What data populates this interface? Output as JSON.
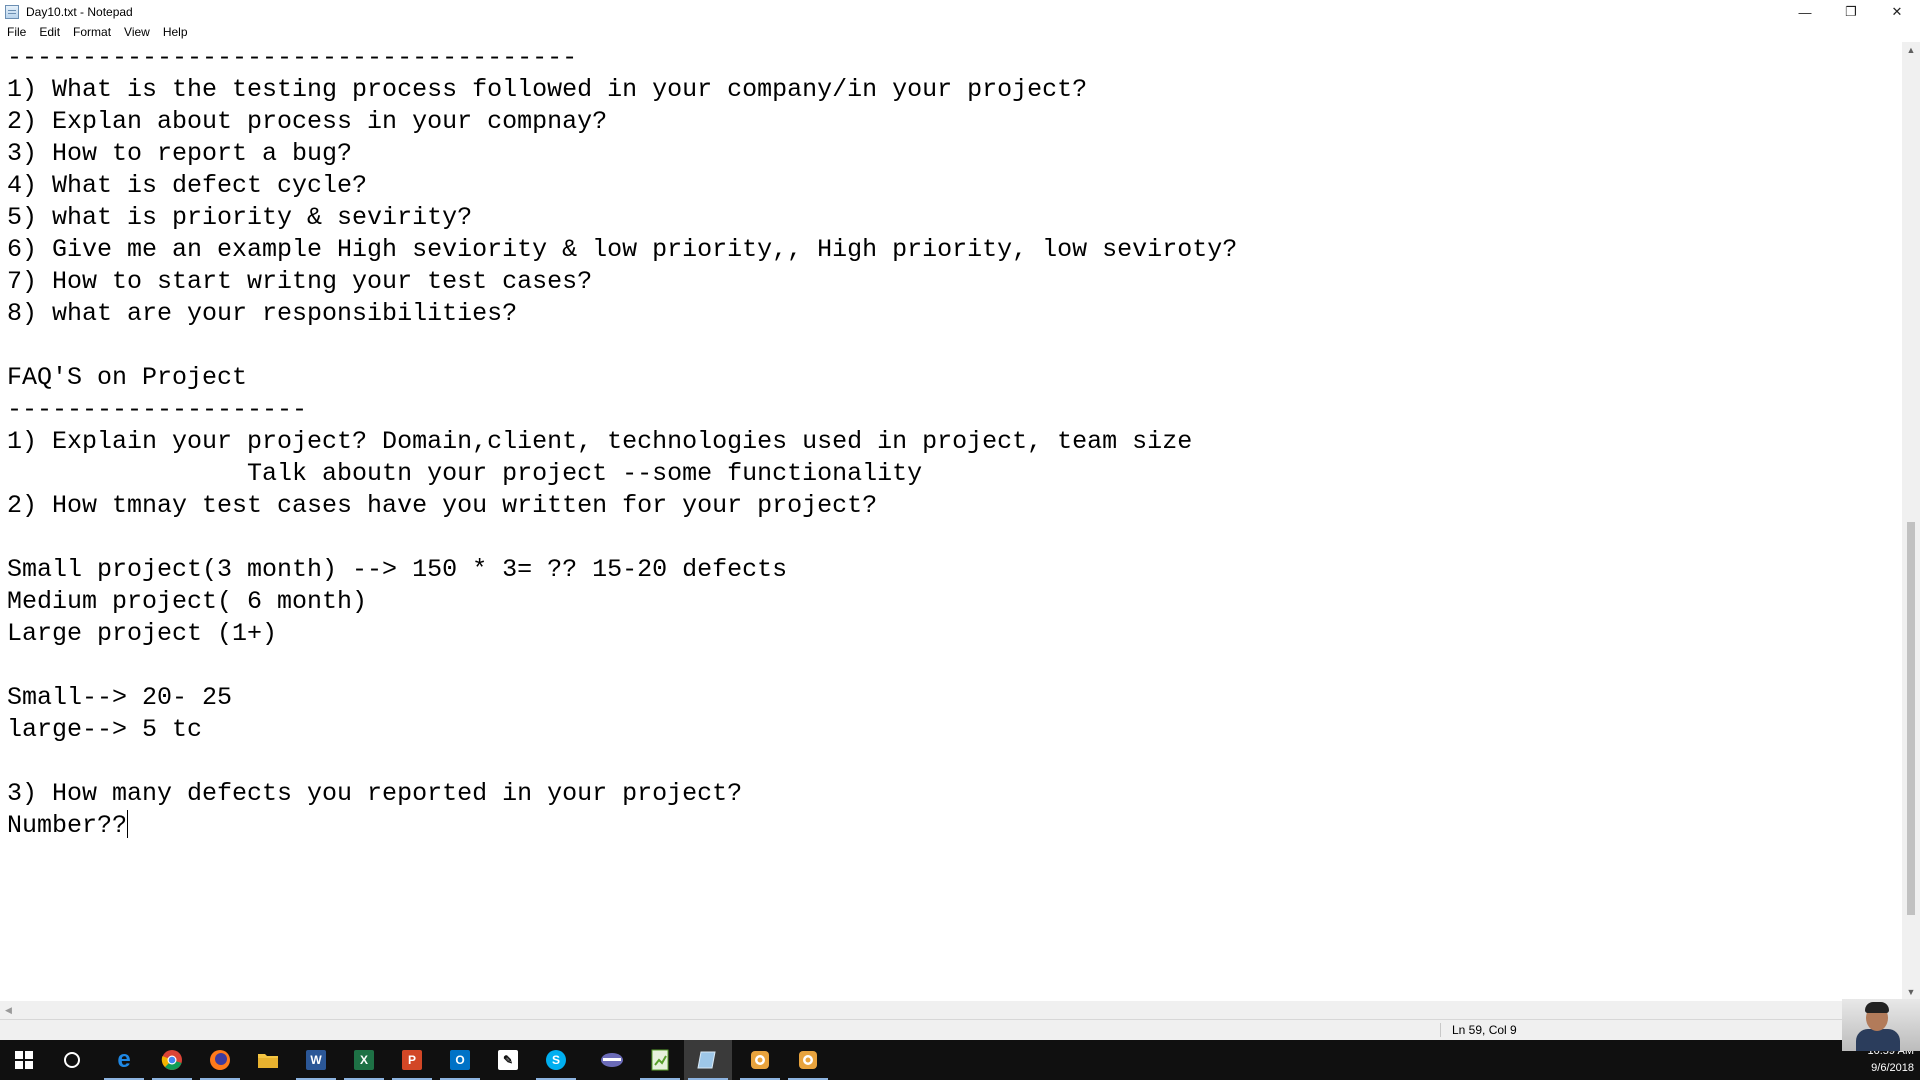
{
  "window": {
    "title": "Day10.txt - Notepad",
    "controls": {
      "minimize": "—",
      "restore": "❐",
      "close": "✕"
    }
  },
  "menu": [
    "File",
    "Edit",
    "Format",
    "View",
    "Help"
  ],
  "editor": {
    "lines": [
      "--------------------------------------",
      "1) What is the testing process followed in your company/in your project?",
      "2) Explan about process in your compnay?",
      "3) How to report a bug?",
      "4) What is defect cycle?",
      "5) what is priority & sevirity?",
      "6) Give me an example High seviority & low priority,, High priority, low seviroty?",
      "7) How to start writng your test cases?",
      "8) what are your responsibilities?",
      "",
      "FAQ'S on Project",
      "--------------------",
      "1) Explain your project? Domain,client, technologies used in project, team size",
      "                Talk aboutn your project --some functionality",
      "2) How tmnay test cases have you written for your project?",
      "",
      "Small project(3 month) --> 150 * 3= ?? 15-20 defects",
      "Medium project( 6 month)",
      "Large project (1+)",
      "",
      "Small--> 20- 25",
      "large--> 5 tc",
      "",
      "3) How many defects you reported in your project?",
      "Number??"
    ]
  },
  "statusbar": {
    "position": "Ln 59, Col 9"
  },
  "taskbar": {
    "items": [
      {
        "name": "start-button",
        "icon": "windows-logo-icon"
      },
      {
        "name": "cortana-button",
        "icon": "search-circle-icon"
      },
      {
        "name": "edge-app",
        "icon": "edge-icon",
        "label": "e",
        "color": "#1e88e5"
      },
      {
        "name": "chrome-app",
        "icon": "chrome-icon",
        "color": "#4caf50"
      },
      {
        "name": "firefox-app",
        "icon": "firefox-icon",
        "color": "#ff7a1a"
      },
      {
        "name": "file-explorer-app",
        "icon": "folder-icon",
        "color": "#f4c542"
      },
      {
        "name": "word-app",
        "icon": "word-icon",
        "label": "W",
        "color": "#2b5797"
      },
      {
        "name": "excel-app",
        "icon": "excel-icon",
        "label": "X",
        "color": "#1e7145"
      },
      {
        "name": "powerpoint-app",
        "icon": "powerpoint-icon",
        "label": "P",
        "color": "#d24726"
      },
      {
        "name": "outlook-app",
        "icon": "outlook-icon",
        "label": "O",
        "color": "#0072c6"
      },
      {
        "name": "sticky-app",
        "icon": "pen-icon",
        "color": "#ffffff"
      },
      {
        "name": "skype-app",
        "icon": "skype-icon",
        "label": "S",
        "color": "#00aff0"
      },
      {
        "name": "generic-app",
        "icon": "drive-icon",
        "color": "#6b6bb8"
      },
      {
        "name": "spreadsheet-app",
        "icon": "spreadsheet-icon",
        "color": "#5aa02c"
      },
      {
        "name": "notepad-app",
        "icon": "notepad-icon",
        "color": "#9ec7e8"
      },
      {
        "name": "camtasia-app-1",
        "icon": "camtasia-icon",
        "color": "#e8a33d"
      },
      {
        "name": "camtasia-app-2",
        "icon": "camtasia-icon",
        "color": "#e8a33d"
      }
    ]
  },
  "clock": {
    "time": "10:59 AM",
    "date": "9/6/2018"
  }
}
